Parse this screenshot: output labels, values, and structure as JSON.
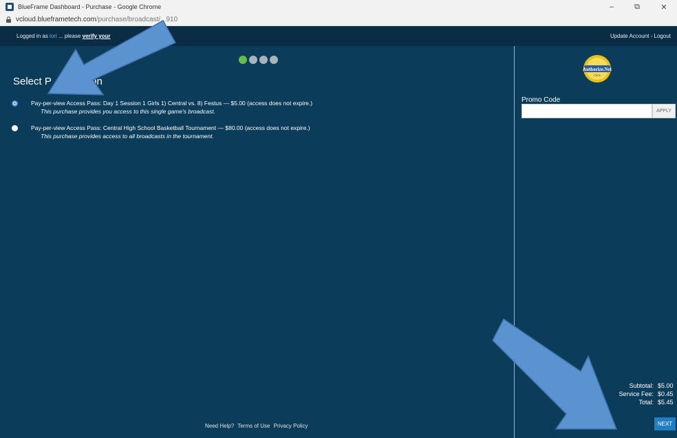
{
  "browser": {
    "window_title": "BlueFrame Dashboard - Purchase - Google Chrome",
    "url_host": "vcloud.blueframetech.com",
    "url_path": "/purchase/broadcast/...910",
    "minimize": "–",
    "maximize": "⧉",
    "close": "✕"
  },
  "topbar": {
    "logged_in_prefix": "Logged in as ",
    "username": "lori",
    "middle": " ... please ",
    "verify": "verify your",
    "account_links": "Update Account - Logout"
  },
  "main": {
    "heading": "Select P          ption",
    "steps": [
      {
        "state": "active"
      },
      {
        "state": "inactive"
      },
      {
        "state": "inactive"
      },
      {
        "state": "inactive"
      }
    ],
    "options": [
      {
        "label": "Pay-per-view Access Pass: Day 1 Session 1 Girls 1) Central vs. 8) Festus — $5.00 (access does not expire.)",
        "description": "This purchase provides you access to this single game's broadcast.",
        "selected": true
      },
      {
        "label": "Pay-per-view Access Pass: Central High School Basketball Tournament — $80.00 (access does not expire.)",
        "description": "This purchase provides access to all broadcasts in the tournament.",
        "selected": false
      }
    ],
    "footer": {
      "help": "Need Help?",
      "terms": "Terms of Use",
      "privacy": "Privacy Policy"
    }
  },
  "sidebar": {
    "seal_text": "Authorize.Net",
    "seal_sub": "Click",
    "promo_label": "Promo Code",
    "promo_value": "",
    "apply_label": "APPLY",
    "subtotal_label": "Subtotal:",
    "subtotal_value": "$5.00",
    "fee_label": "Service Fee:",
    "fee_value": "$0.45",
    "total_label": "Total:",
    "total_value": "$5.45",
    "next_label": "NEXT"
  },
  "colors": {
    "page_bg": "#0b3c5a",
    "topbar_bg": "#0a2c44",
    "step_active": "#62bd4a",
    "next_button": "#1f7fc4",
    "annotation_arrow": "#5b93d0"
  }
}
